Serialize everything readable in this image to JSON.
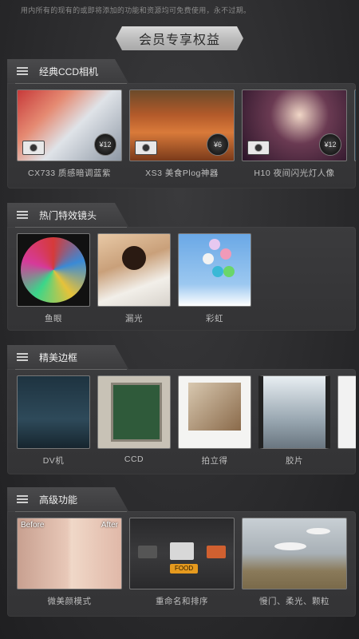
{
  "notice": "用内所有的现有的或即将添加的功能和资源均可免费使用，永不过期。",
  "badge": "会员专享权益",
  "sections": [
    {
      "title": "经典CCD相机",
      "items": [
        {
          "label": "CX733 质感暗调蓝紫",
          "price": "¥12",
          "icon": "camera-icon"
        },
        {
          "label": "XS3 美食Plog神器",
          "price": "¥6",
          "icon": "camera-icon"
        },
        {
          "label": "H10 夜间闪光灯人像",
          "price": "¥12",
          "icon": "camera-icon"
        }
      ]
    },
    {
      "title": "热门特效镜头",
      "items": [
        {
          "label": "鱼眼"
        },
        {
          "label": "漏光"
        },
        {
          "label": "彩虹"
        }
      ]
    },
    {
      "title": "精美边框",
      "items": [
        {
          "label": "DV机"
        },
        {
          "label": "CCD"
        },
        {
          "label": "拍立得"
        },
        {
          "label": "胶片"
        }
      ]
    },
    {
      "title": "高级功能",
      "items": [
        {
          "label": "微美颜模式",
          "before": "Before",
          "after": "After"
        },
        {
          "label": "重命名和排序",
          "tag": "FOOD"
        },
        {
          "label": "慢门、柔光、颗粒"
        }
      ]
    }
  ]
}
